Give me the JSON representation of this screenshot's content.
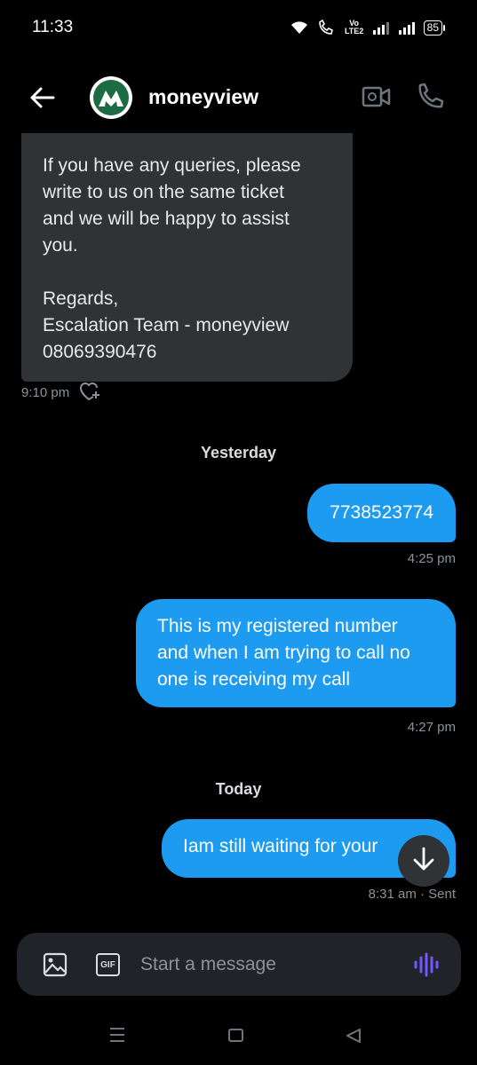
{
  "status_bar": {
    "time": "11:33",
    "battery": "85",
    "network_label": "Vo LTE2"
  },
  "header": {
    "contact_name": "moneyview",
    "avatar_letter": "M",
    "back_icon": "arrow-left-icon",
    "video_icon": "video-camera-icon",
    "phone_icon": "phone-icon",
    "brand_color": "#1d6b43"
  },
  "messages": {
    "incoming": {
      "text": "If you have any queries, please\nwrite to us on the same ticket\nand we will be happy to assist\nyou.\n\nRegards,\nEscalation Team - moneyview\n08069390476",
      "time": "9:10 pm",
      "react_icon": "heart-plus-icon"
    },
    "separators": {
      "yesterday": "Yesterday",
      "today": "Today"
    },
    "outgoing": [
      {
        "text": "7738523774",
        "time": "4:25 pm"
      },
      {
        "text": "This is my registered number\nand when I am trying to call no\none is receiving my call",
        "time": "4:27 pm"
      },
      {
        "text": "Iam still waiting for your",
        "time": "8:31 am · Sent"
      }
    ]
  },
  "composer": {
    "placeholder": "Start a message",
    "image_icon": "image-icon",
    "gif_label": "GIF",
    "voice_icon": "voice-wave-icon"
  },
  "colors": {
    "background": "#000000",
    "incoming_bubble": "#2f3336",
    "outgoing_bubble": "#1d9bf0",
    "accent_voice": "#7856ff"
  }
}
